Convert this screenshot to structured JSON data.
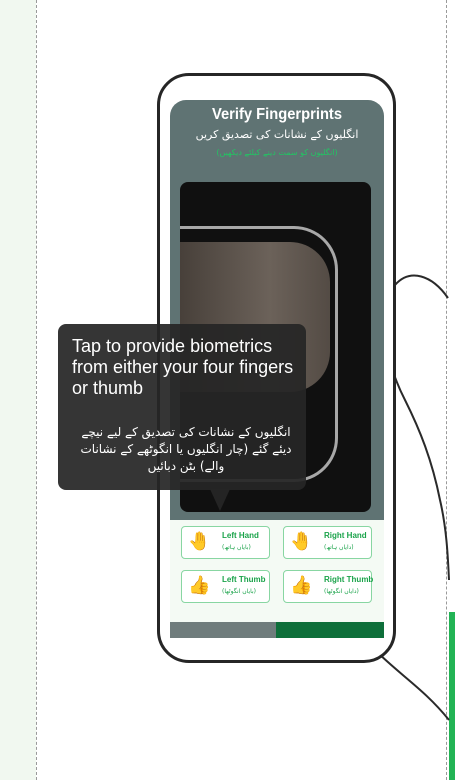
{
  "screen": {
    "title": "Verify Fingerprints",
    "urdu_title": "انگلیوں کے نشانات کی تصدیق کریں",
    "urdu_subtitle": "(انگلیوں کو سمت دینے کیلئے دیکھیں)"
  },
  "tooltip": {
    "english": "Tap to provide biometrics from either your four fingers or thumb",
    "urdu": "انگلیوں کے نشانات کی تصدیق کے لیے نیچے دیئے گئے (چار انگلیوں یا انگوٹھے کے نشانات والے) بٹن دبائیں"
  },
  "buttons": [
    {
      "label": "Left Hand",
      "urdu": "(بایاں ہاتھ)",
      "icon": "left-hand-icon"
    },
    {
      "label": "Right Hand",
      "urdu": "(دایاں ہاتھ)",
      "icon": "right-hand-icon"
    },
    {
      "label": "Left Thumb",
      "urdu": "(بایاں انگوٹھا)",
      "icon": "left-thumb-icon"
    },
    {
      "label": "Right Thumb",
      "urdu": "(دایاں انگوٹھا)",
      "icon": "right-thumb-icon"
    }
  ],
  "colors": {
    "accent": "#22b455",
    "dark_green": "#0e6f3a",
    "screen_bg": "#5f7373",
    "tooltip_bg": "#262626"
  }
}
